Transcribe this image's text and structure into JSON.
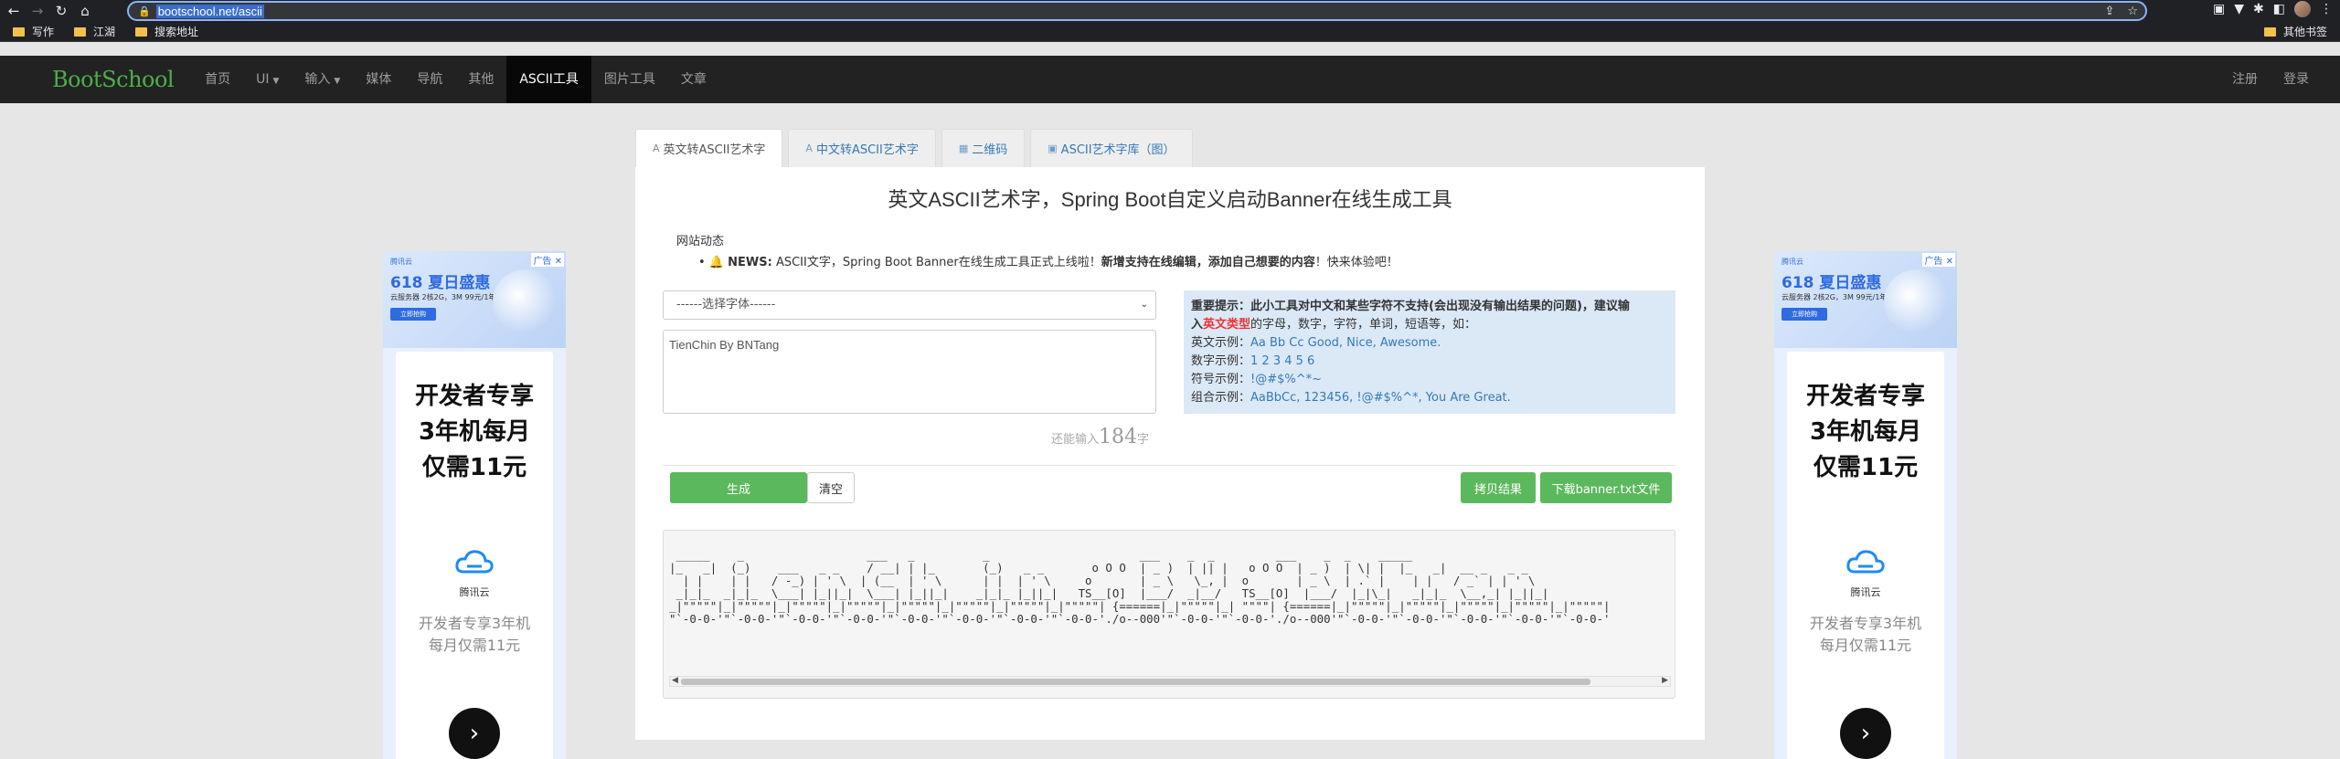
{
  "browser": {
    "url": "bootschool.net/ascii",
    "bookmarks": [
      "写作",
      "江湖",
      "搜索地址"
    ],
    "bookmarks_right": "其他书签"
  },
  "navbar": {
    "brand": "BootSchool",
    "items": [
      {
        "label": "首页"
      },
      {
        "label": "UI"
      },
      {
        "label": "输入"
      },
      {
        "label": "媒体"
      },
      {
        "label": "导航"
      },
      {
        "label": "其他"
      },
      {
        "label": "ASCII工具"
      },
      {
        "label": "图片工具"
      },
      {
        "label": "文章"
      }
    ],
    "active": "ASCII工具",
    "register": "注册",
    "login": "登录"
  },
  "tabs": [
    {
      "label": "英文转ASCII艺术字"
    },
    {
      "label": "中文转ASCII艺术字"
    },
    {
      "label": "二维码"
    },
    {
      "label": "ASCII艺术字库（图）"
    }
  ],
  "page": {
    "title": "英文ASCII艺术字，Spring Boot自定义启动Banner在线生成工具",
    "news_heading": "网站动态",
    "news_label": "NEWS:",
    "news_text": "ASCII文字，Spring Boot Banner在线生成工具正式上线啦！",
    "news_bold": "新增支持在线编辑，添加自己想要的内容",
    "news_tail": "！快来体验吧！"
  },
  "form": {
    "font_select_value": "------选择字体------",
    "input_text": "TienChin By BNTang",
    "remaining_prefix": "还能输入",
    "remaining_count": "184",
    "remaining_suffix": "字"
  },
  "tips": {
    "heading": "重要提示：",
    "line1": "此小工具对中文和某些字符不支持(会出现没有输出结果的问题)，建议输",
    "line2_pre": "入",
    "line2_red": "英文类型",
    "line2_post": "的字母，数字，字符，单词，短语等，如：",
    "ex_en_label": "英文示例：",
    "ex_en": "Aa Bb Cc Good, Nice, Awesome.",
    "ex_num_label": "数字示例：",
    "ex_num": "1 2 3 4 5 6",
    "ex_sym_label": "符号示例：",
    "ex_sym": "!@#$%^*~",
    "ex_mix_label": "组合示例：",
    "ex_mix": "AaBbCc, 123456, !@#$%^*, You Are Great."
  },
  "buttons": {
    "generate": "生成",
    "clear": "清空",
    "copy": "拷贝结果",
    "download": "下载banner.txt文件"
  },
  "ascii_output": " _____    _                  ___   _          _                      ___    _  _         ___    _  _    _____                            \n|_   _|  (_)    ___   _ _    / __| | |_       (_)   _ _       o O O  | _ )  | || |   o O O  | _ )  | \\| |  |_   _|  __ _   _ _             \n  | |    | |   / -_) | ' \\  | (__  | ' \\      | |  | ' \\     o       | _ \\   \\_, |  o       | _ \\  | .` |    | |   / _` | | ' \\            \n _|_|_  _|_|_  \\___| |_||_|  \\___| |_||_|    _|_|_ |_||_|   TS__[O]  |___/  _|__/   TS__[O]  |___/  |_|\\_|   _|_|_  \\__,_| |_||_|           \n_|\"\"\"\"\"|_|\"\"\"\"\"|_|\"\"\"\"\"|_|\"\"\"\"\"|_|\"\"\"\"\"|_|\"\"\"\"\"|_|\"\"\"\"\"|_|\"\"\"\"\"| {======|_|\"\"\"\"\"|_| \"\"\"\"| {======|_|\"\"\"\"\"|_|\"\"\"\"\"|_|\"\"\"\"\"|_|\"\"\"\"\"|_|\"\"\"\"\"| \n\"`-0-0-'\"`-0-0-'\"`-0-0-'\"`-0-0-'\"`-0-0-'\"`-0-0-'\"`-0-0-'\"`-0-0-'./o--000'\"`-0-0-'\"`-0-0-'./o--000'\"`-0-0-'\"`-0-0-'\"`-0-0-'\"`-0-0-'\"`-0-0-' ",
  "ads": {
    "badge": "广告",
    "brand": "腾讯云",
    "headline": "618 夏日盛惠",
    "sub": "云服务器 2核2G，3M 99元/1年",
    "cta": "立即抢购",
    "big_text": "开发者专享3年机每月仅需11元",
    "logo_text": "腾讯云",
    "small_text": "开发者专享3年机每月仅需11元"
  }
}
